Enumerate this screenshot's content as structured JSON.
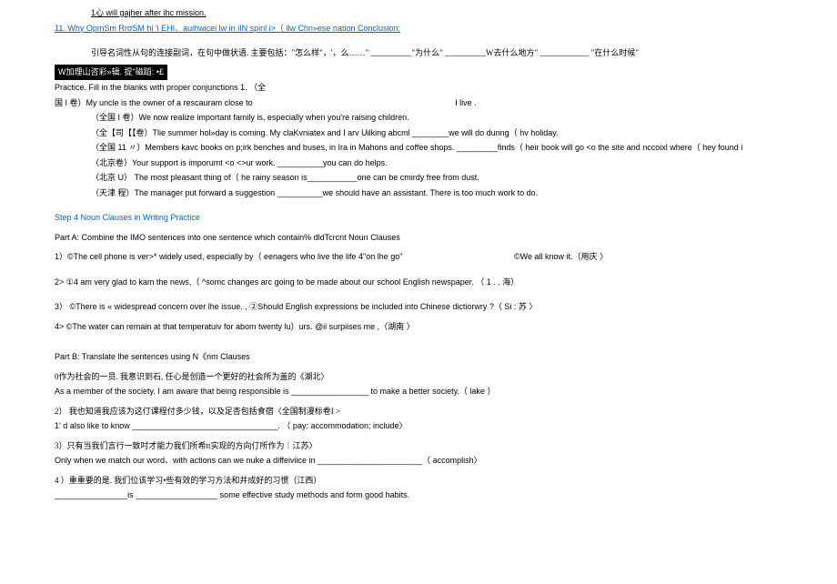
{
  "top": {
    "l1": "1心  will gajher after ihc mission.",
    "l2": "11. Why OpmSm RrσSM hi 'i EHI、auihwicei lw in iIN spiril i>（ llw Chn»ese nation Conclusion:"
  },
  "intro": {
    "chinese": "引导名词性从句的连接副词，在句中做状语. 主要包括：\"怎么样\"，'，么……\" __________\"为什么\" __________W去什么地方\" ____________ \"在什么时候\""
  },
  "blackbar": "W加理山咨彩»辑. 提\"磁蹈: •£",
  "practice": {
    "header": "Practice. Fill in the blanks with proper conjunctions 1.          （全",
    "q1a": "国 I 卷）My uncle is the owner of a rescauram close to",
    "q1b": "I live .",
    "q2": "（全国 I 卷）We now realize                     important family is, especially when you're raising children.",
    "q3": "（全【司【【卷）Tlie summer hol»day is coming. My claKvniatex and I arv Uilking abcml ________we will do dunng（ hv holiday.",
    "q4": "（全国  11 〃）Members kavc books on p;irk benches and buses, in Ira in Mahons and coffee shops. _________finds（ heir book will go <o the site and nccoixl where（ hey found i",
    "q5": "（北京卷）Your support is imporumt <o <>ur work. __________you can do helps.",
    "q6": "（北京   U）  The most pleasant thing of（ he rainy season is___________one can be cmirdy free from dust.",
    "q7": "（天津   程）The manager put forward a suggestion __________we should have an assistant. There is too much work to do."
  },
  "step4": {
    "title": "Step 4 Noun Clauses in Writing Practice",
    "partA": {
      "header": "Part A: Combine the IMO sentences into one sentence which contain% dldTcrcnt Noun Clauses",
      "q1a": "1）©The cell phone is ver>* widely used, especially by（ eenagers who live the life   4\"on lhe go\"",
      "q1b": "©We all know it.（用庆 〉",
      "q2": "2> ①4 am very glad to kam the news,（ ^somc changes arc going to be made about our school English newspaper. （ 1 . . 海）",
      "q3": "3） ©There is « widespread concern over lhe issue.      , ②Should English expressions be included into Chinese dictiorwry ?（ Si : 苏 〉",
      "q4": "4> ©The water can remain at that temperatuiv for abom twenty lu）urs. @ii surpiises me ,（湖南 〉"
    },
    "partB": {
      "header": "Part B: Translate lhe sentences using N《nm Clauses",
      "q0cn": "0作为社会的一员. 我意识到石, 任心是创造一个更好的社会所为盖的《湖北〉",
      "q0en": "As a member of the society. I am aware that being responsible is  _________________ to make a better society.（ lake ）",
      "q2cn": "2） 我也知道我应该为这仃课程付多少钱，以及足杏包括食宿〈全国制漫标卷I >",
      "q2en": "1' d also like to know  ________________________________. （ pay: accommodation; include〉",
      "q3cn": "3）只有当我们言行一致吋才能力我们所希tt实现的方向仃所作为｜江苏〉",
      "q3en": "Only when we match our word、with actions can we nuke a diffeiviice in _______________________（ accomplish〉",
      "q4cn": "4 ）重重要的是. 我们位该学习•些有效的学习方法和并成好的习惯（江西）",
      "q4en": " ________________is  __________________ some effective study methods and form good habits."
    }
  }
}
